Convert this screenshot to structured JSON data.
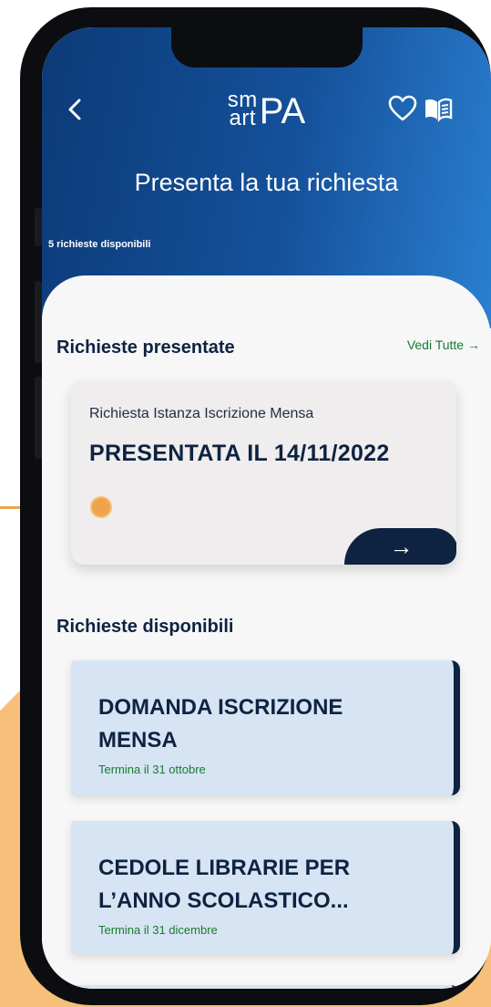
{
  "header": {
    "logo_top": "sm",
    "logo_bottom": "art",
    "logo_pa": "PA",
    "page_title": "Presenta la tua richiesta",
    "available_count": "5 richieste disponibili"
  },
  "presented": {
    "section_title": "Richieste presentate",
    "see_all_label": "Vedi Tutte →",
    "card": {
      "subtitle": "Richiesta Istanza Iscrizione Mensa",
      "status": "PRESENTATA IL 14/11/2022",
      "arrow": "→"
    }
  },
  "available": {
    "section_title": "Richieste disponibili",
    "items": [
      {
        "title": "DOMANDA ISCRIZIONE MENSA",
        "deadline": "Termina il 31 ottobre"
      },
      {
        "title": "CEDOLE LIBRARIE PER L’ANNO SCOLASTICO...",
        "deadline": "Termina il 31 dicembre"
      }
    ]
  },
  "icons": {
    "back": "chevron-left-icon",
    "favorites": "heart-icon",
    "guide": "book-icon"
  },
  "colors": {
    "primary_dark": "#0e2341",
    "header_blue": "#15519b",
    "accent_green": "#1a7a2e",
    "card_blue": "#d6e4f3",
    "backdrop_orange": "#f6c07a"
  }
}
